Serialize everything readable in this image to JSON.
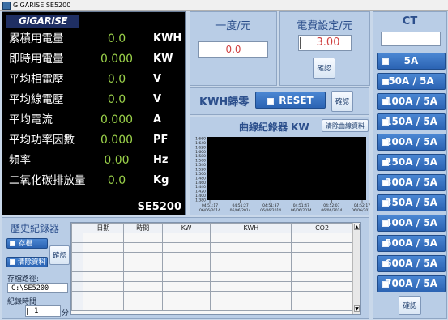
{
  "window": {
    "title": "GIGARISE  SE5200"
  },
  "meter": {
    "logo": "GIGARISE",
    "model": "SE5200",
    "rows": [
      {
        "label": "累積用電量",
        "value": "0.0",
        "unit": "KWH"
      },
      {
        "label": "即時用電量",
        "value": "0.000",
        "unit": "KW"
      },
      {
        "label": "平均相電壓",
        "value": "0.0",
        "unit": "V"
      },
      {
        "label": "平均線電壓",
        "value": "0.0",
        "unit": "V"
      },
      {
        "label": "平均電流",
        "value": "0.000",
        "unit": "A"
      },
      {
        "label": "平均功率因數",
        "value": "0.000",
        "unit": "PF"
      },
      {
        "label": "頻率",
        "value": "0.00",
        "unit": "Hz"
      },
      {
        "label": "二氧化碳排放量",
        "value": "0.0",
        "unit": "Kg"
      }
    ]
  },
  "price": {
    "title": "一度/元",
    "value": "0.0"
  },
  "rate": {
    "title": "電費設定/元",
    "value": "3.00",
    "confirm": "確認"
  },
  "kwh_reset": {
    "label": "KWH歸零",
    "reset": "RESET",
    "confirm": "確認"
  },
  "chart": {
    "title": "曲線紀錄器 KW",
    "clear": "清除曲線資料",
    "y_ticks": [
      "1.660",
      "1.640",
      "1.620",
      "1.600",
      "1.580",
      "1.560",
      "1.540",
      "1.520",
      "1.500",
      "1.480",
      "1.460",
      "1.440",
      "1.420",
      "1.400",
      "1.380"
    ],
    "x_ticks": [
      {
        "time": "04:51:17",
        "date": "06/06/2014"
      },
      {
        "time": "04:51:27",
        "date": "06/06/2014"
      },
      {
        "time": "04:51:37",
        "date": "06/06/2014"
      },
      {
        "time": "04:51:47",
        "date": "06/06/2014"
      },
      {
        "time": "04:52:07",
        "date": "06/06/2014"
      },
      {
        "time": "04:52:17",
        "date": "06/06/2014"
      }
    ]
  },
  "history": {
    "title": "歷史紀錄器",
    "save": "存檔",
    "clear": "清除資料",
    "confirm": "確認",
    "path_label": "存檔路徑:",
    "path": "C:\\SE5200",
    "time_label": "紀錄時間",
    "time_value": "1",
    "time_unit": "分",
    "columns": [
      "日期",
      "時間",
      "KW",
      "KWH",
      "CO2"
    ]
  },
  "ct": {
    "title": "CT",
    "input_value": "",
    "options": [
      "5A",
      "50A / 5A",
      "100A / 5A",
      "150A / 5A",
      "200A / 5A",
      "250A / 5A",
      "300A / 5A",
      "350A / 5A",
      "400A / 5A",
      "500A / 5A",
      "600A / 5A",
      "700A / 5A"
    ],
    "confirm": "確認"
  }
}
